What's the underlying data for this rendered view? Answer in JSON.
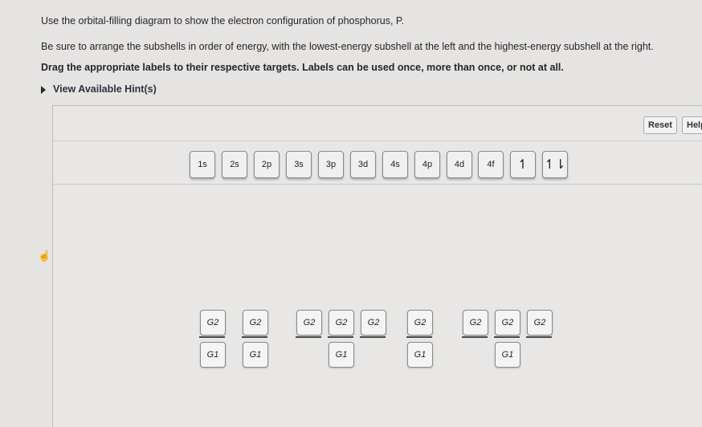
{
  "instructions": {
    "line1": "Use the orbital-filling diagram to show the electron configuration of phosphorus, P.",
    "line2": "Be sure to arrange the subshells in order of energy, with the lowest-energy subshell at the left and the highest-energy subshell at the right.",
    "line3": "Drag the appropriate labels to their respective targets. Labels can be used once, more than once, or not at all."
  },
  "hint": {
    "label": "View Available Hint(s)"
  },
  "toolbar": {
    "reset": "Reset",
    "help": "Help"
  },
  "labels": [
    "1s",
    "2s",
    "2p",
    "3s",
    "3p",
    "3d",
    "4s",
    "4p",
    "4d",
    "4f",
    "↿",
    "↿⇂"
  ],
  "targets": {
    "g2": [
      "G2",
      "G2",
      "G2",
      "G2",
      "G2",
      "G2",
      "G2",
      "G2",
      "G2"
    ],
    "g1": [
      "G1",
      "G1",
      "G1",
      "G1",
      "G1"
    ]
  }
}
